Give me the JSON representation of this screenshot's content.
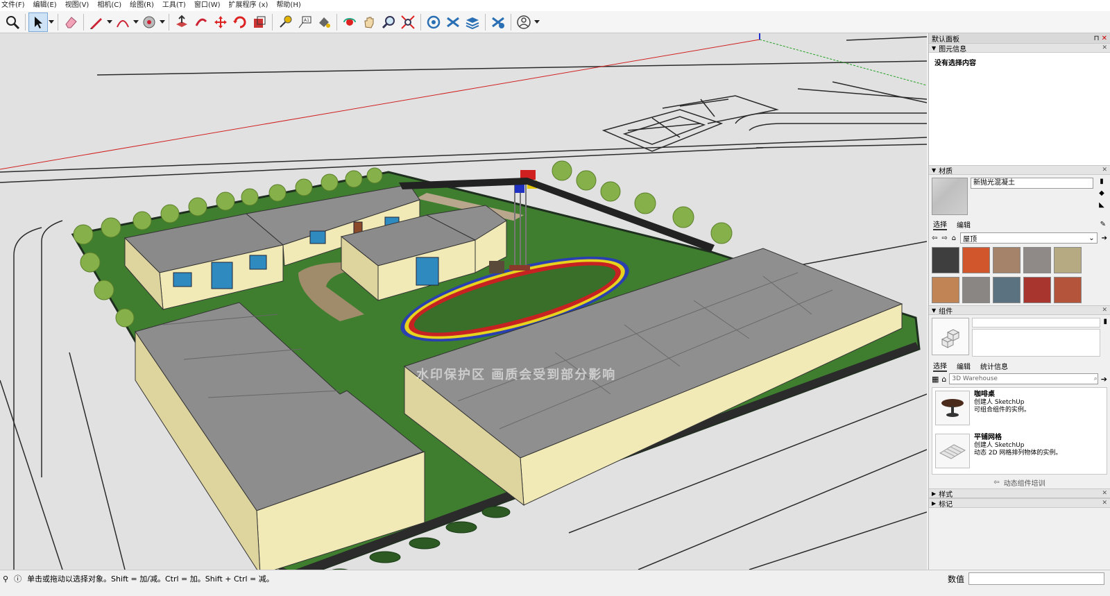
{
  "menu": [
    "文件(F)",
    "编辑(E)",
    "视图(V)",
    "相机(C)",
    "绘图(R)",
    "工具(T)",
    "窗口(W)",
    "扩展程序 (x)",
    "帮助(H)"
  ],
  "tray": {
    "title": "默认面板",
    "entity_info": {
      "title": "图元信息",
      "body": "没有选择内容"
    },
    "materials": {
      "title": "材质",
      "name": "新抛光混凝土",
      "tab_select": "选择",
      "tab_edit": "编辑",
      "collection": "屋顶",
      "swatch_colors": [
        "#3e3e3e",
        "#d2562c",
        "#a5826a",
        "#8f8a88",
        "#b5aa82",
        "#c08455",
        "#8a8683",
        "#5b7380",
        "#a8362f",
        "#b4543a"
      ]
    },
    "components": {
      "title": "组件",
      "tab_select": "选择",
      "tab_edit": "编辑",
      "tab_stats": "统计信息",
      "search_placeholder": "3D Warehouse",
      "items": [
        {
          "name": "咖啡桌",
          "creator": "创建人 SketchUp",
          "desc": "可组合组件的实例。"
        },
        {
          "name": "平铺网格",
          "creator": "创建人 SketchUp",
          "desc": "动态 2D 网格排列物体的实例。"
        }
      ],
      "footer": "动态组件培训"
    },
    "styles_title": "样式",
    "tags_title": "标记"
  },
  "viewport": {
    "watermark": "水印保护区   画质会受到部分影响"
  },
  "status": {
    "hint": "单击或拖动以选择对象。Shift = 加/减。Ctrl = 加。Shift + Ctrl = 减。",
    "measurements_label": "数值"
  }
}
